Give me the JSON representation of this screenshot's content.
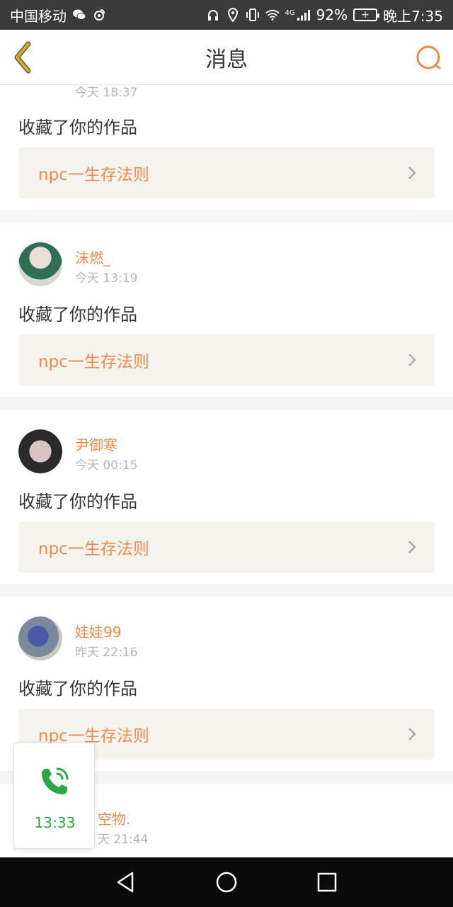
{
  "status_bar": {
    "carrier": "中国移动",
    "battery": "92%",
    "time": "晚上7:35",
    "network": "4G"
  },
  "header": {
    "title": "消息"
  },
  "messages": [
    {
      "time": "今天 18:37",
      "action": "收藏了你的作品",
      "work_title": "npc一生存法则"
    },
    {
      "username": "沫燃_",
      "time": "今天 13:19",
      "action": "收藏了你的作品",
      "work_title": "npc一生存法则"
    },
    {
      "username": "尹御寒",
      "time": "今天 00:15",
      "action": "收藏了你的作品",
      "work_title": "npc一生存法则"
    },
    {
      "username": "娃娃99",
      "time": "昨天 22:16",
      "action": "收藏了你的作品",
      "work_title": "npc一生存法则"
    },
    {
      "username": "空物.",
      "time": "天 21:44"
    }
  ],
  "call_widget": {
    "duration": "13:33"
  },
  "colors": {
    "accent": "#f08a4b",
    "call_green": "#2aa845",
    "back_arrow": "#d9b21f"
  }
}
